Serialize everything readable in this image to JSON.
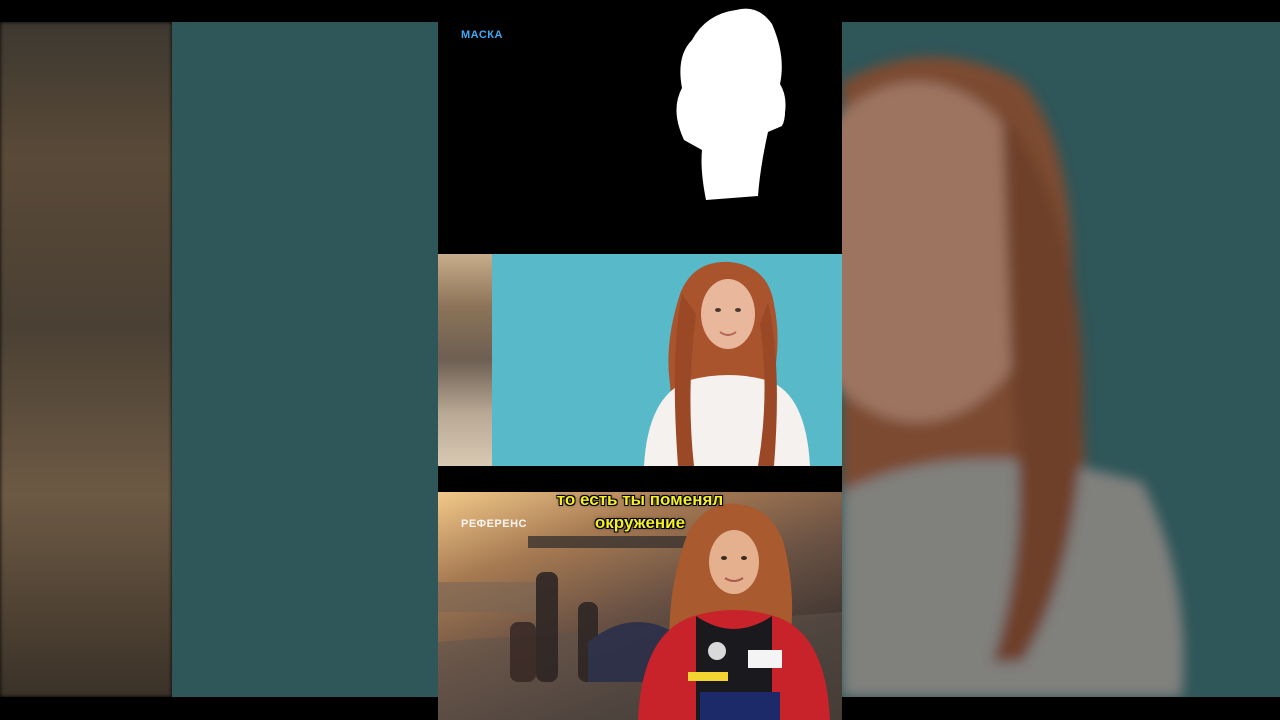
{
  "labels": {
    "mask": "МАСКА",
    "reference": "РЕФЕРЕНС"
  },
  "subtitle": {
    "line1": "то есть ты поменял",
    "line2": "окружение"
  },
  "colors": {
    "label_blue": "#3fa9f5",
    "label_white": "#ffffff",
    "subtitle_yellow": "#f5ef2a",
    "teal_background": "#58b9c9"
  }
}
